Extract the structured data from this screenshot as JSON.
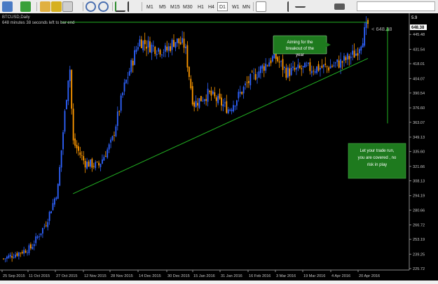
{
  "toolbar": {
    "timeframes": [
      "M1",
      "M5",
      "M15",
      "M30",
      "H1",
      "H4",
      "D1",
      "W1",
      "MN"
    ],
    "active_timeframe": "D1"
  },
  "chart": {
    "symbol_line": "BTCUSD,Daily",
    "countdown_line": "648 minutes 38 seconds left to bar end",
    "corner_value": "5.9",
    "price_tag": "648.38",
    "current_price_label": "< 648.38",
    "annotation_top": "Aiming for the breakout of the year",
    "annotation_bottom": "Let your trade run, you are covered , no risk in play",
    "y_ticks": [
      "445.48",
      "431.54",
      "418.01",
      "404.07",
      "390.54",
      "376.60",
      "363.07",
      "349.13",
      "335.60",
      "321.66",
      "308.13",
      "294.19",
      "280.66",
      "266.72",
      "253.19",
      "239.25",
      "225.72"
    ],
    "x_ticks": [
      "25 Sep 2015",
      "11 Oct 2015",
      "27 Oct 2015",
      "12 Nov 2015",
      "28 Nov 2015",
      "14 Dec 2015",
      "30 Dec 2015",
      "15 Jan 2016",
      "31 Jan 2016",
      "16 Feb 2016",
      "3 Mar 2016",
      "19 Mar 2016",
      "4 Apr 2016",
      "20 Apr 2016"
    ],
    "colors": {
      "background": "#000000",
      "bull": "#2f63ff",
      "bear": "#ff9900",
      "trendline": "#22b022",
      "annotation_bg": "#1e7a1e",
      "axis_text": "#c8c8c8"
    }
  },
  "chart_data": {
    "type": "candlestick",
    "symbol": "BTCUSD",
    "timeframe": "Daily",
    "x_range": [
      "2015-09-25",
      "2016-04-27"
    ],
    "ylim": [
      225.72,
      459
    ],
    "current_price": 648.38,
    "approx_close_path": [
      [
        "2015-09-25",
        235
      ],
      [
        "2015-10-11",
        245
      ],
      [
        "2015-10-20",
        268
      ],
      [
        "2015-10-27",
        300
      ],
      [
        "2015-11-03",
        420
      ],
      [
        "2015-11-05",
        345
      ],
      [
        "2015-11-12",
        325
      ],
      [
        "2015-11-20",
        322
      ],
      [
        "2015-11-28",
        345
      ],
      [
        "2015-12-05",
        395
      ],
      [
        "2015-12-14",
        440
      ],
      [
        "2015-12-20",
        435
      ],
      [
        "2015-12-30",
        430
      ],
      [
        "2016-01-04",
        440
      ],
      [
        "2016-01-10",
        435
      ],
      [
        "2016-01-15",
        380
      ],
      [
        "2016-01-24",
        390
      ],
      [
        "2016-02-05",
        375
      ],
      [
        "2016-02-16",
        400
      ],
      [
        "2016-02-25",
        415
      ],
      [
        "2016-03-03",
        425
      ],
      [
        "2016-03-10",
        410
      ],
      [
        "2016-03-19",
        413
      ],
      [
        "2016-04-04",
        415
      ],
      [
        "2016-04-12",
        420
      ],
      [
        "2016-04-20",
        428
      ],
      [
        "2016-04-27",
        455
      ]
    ],
    "trendlines": [
      {
        "name": "resistance",
        "from": [
          "2015-10-29",
          457
        ],
        "to": [
          "2016-04-27",
          457
        ]
      },
      {
        "name": "support",
        "from": [
          "2015-11-05",
          296
        ],
        "to": [
          "2016-04-27",
          423
        ]
      }
    ]
  }
}
